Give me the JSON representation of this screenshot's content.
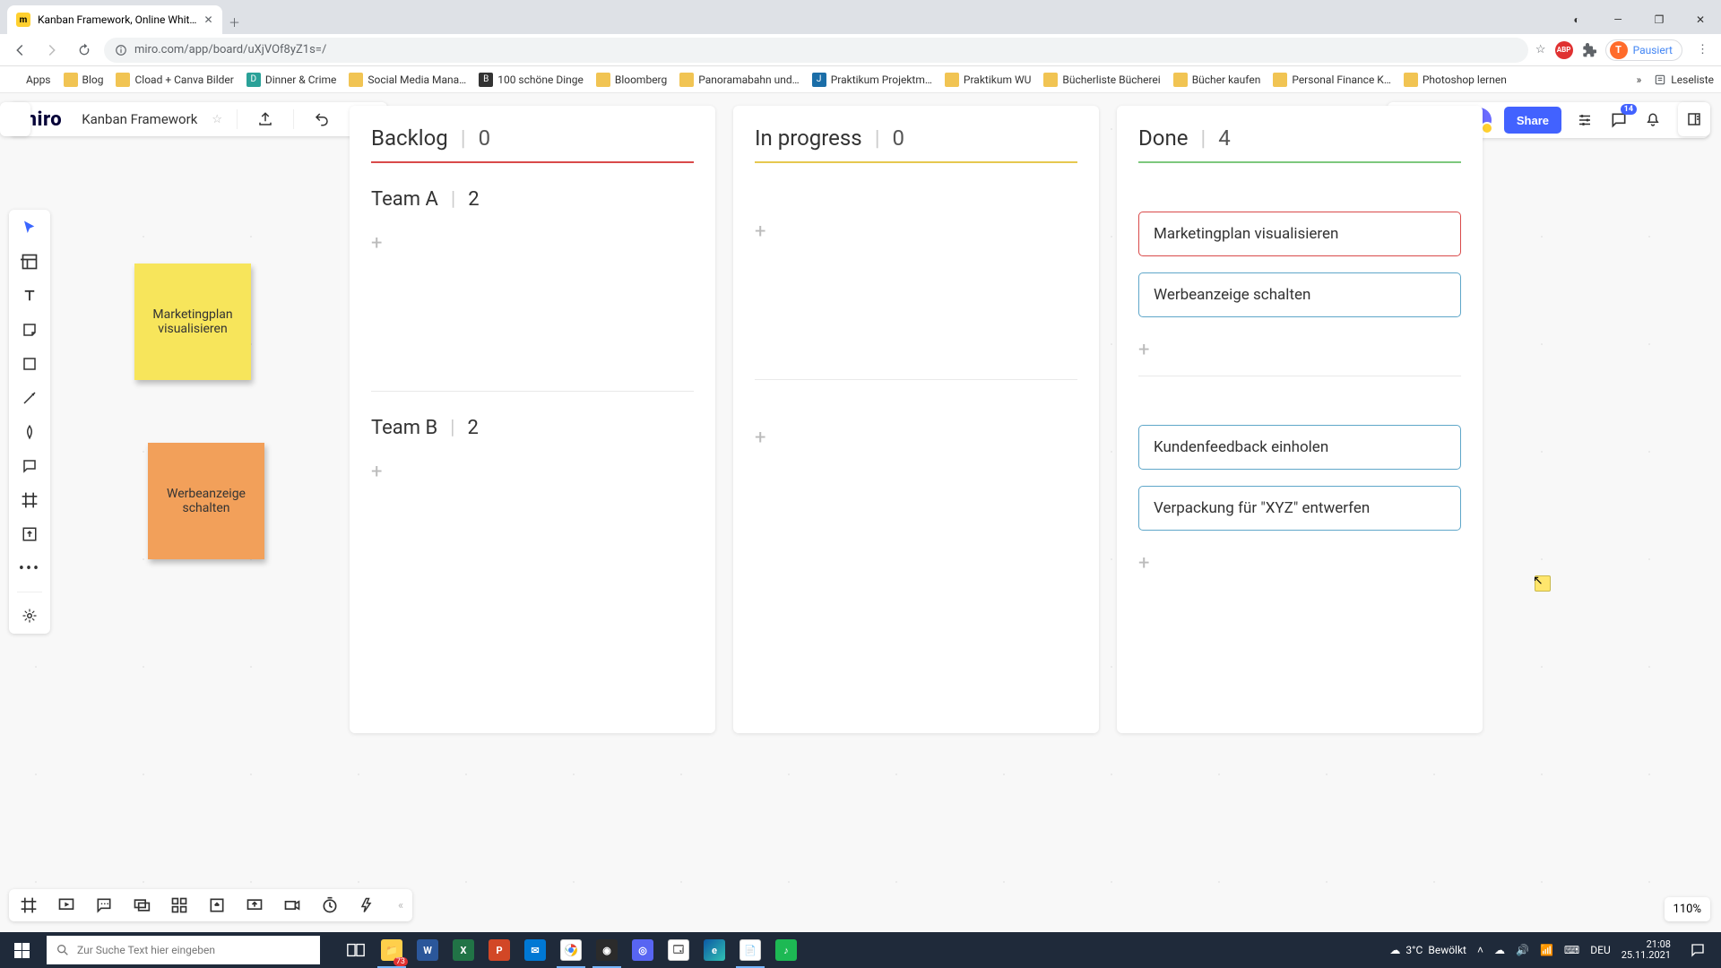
{
  "browser": {
    "tab_title": "Kanban Framework, Online Whit…",
    "url": "miro.com/app/board/uXjVOf8yZ1s=/",
    "paused_label": "Pausiert",
    "win_minimize": "—",
    "win_maximize": "❐",
    "win_close": "✕"
  },
  "bookmarks": {
    "apps": "Apps",
    "items": [
      "Blog",
      "Cload + Canva Bilder",
      "Dinner & Crime",
      "Social Media Mana…",
      "100 schöne Dinge",
      "Bloomberg",
      "Panoramabahn und…",
      "Praktikum Projektm…",
      "Praktikum WU",
      "Bücherliste Bücherei",
      "Bücher kaufen",
      "Personal Finance K…",
      "Photoshop lernen"
    ],
    "reading_list": "Leseliste"
  },
  "miro": {
    "logo": "miro",
    "board_name": "Kanban Framework",
    "share": "Share",
    "badge": "14",
    "avatar_initial": "T",
    "zoom": "110%"
  },
  "stickies": {
    "yellow": "Marketingplan visualisieren",
    "orange": "Werbeanzeige schalten"
  },
  "kanban": {
    "columns": [
      {
        "title": "Backlog",
        "count": "0",
        "underline": "u-red"
      },
      {
        "title": "In progress",
        "count": "0",
        "underline": "u-yellow"
      },
      {
        "title": "Done",
        "count": "4",
        "underline": "u-green"
      }
    ],
    "lanes": [
      {
        "name": "Team A",
        "count": "2"
      },
      {
        "name": "Team B",
        "count": "2"
      }
    ],
    "done_team_a": [
      {
        "text": "Marketingplan visualisieren",
        "cls": "red"
      },
      {
        "text": "Werbeanzeige schalten",
        "cls": "blue"
      }
    ],
    "done_team_b": [
      {
        "text": "Kundenfeedback einholen",
        "cls": "blue"
      },
      {
        "text": "Verpackung für \"XYZ\" entwerfen",
        "cls": "blue"
      }
    ]
  },
  "taskbar": {
    "search_placeholder": "Zur Suche Text hier eingeben",
    "weather_temp": "3°C",
    "weather_text": "Bewölkt",
    "lang": "DEU",
    "time": "21:08",
    "date": "25.11.2021",
    "explorer_badge": "73"
  }
}
